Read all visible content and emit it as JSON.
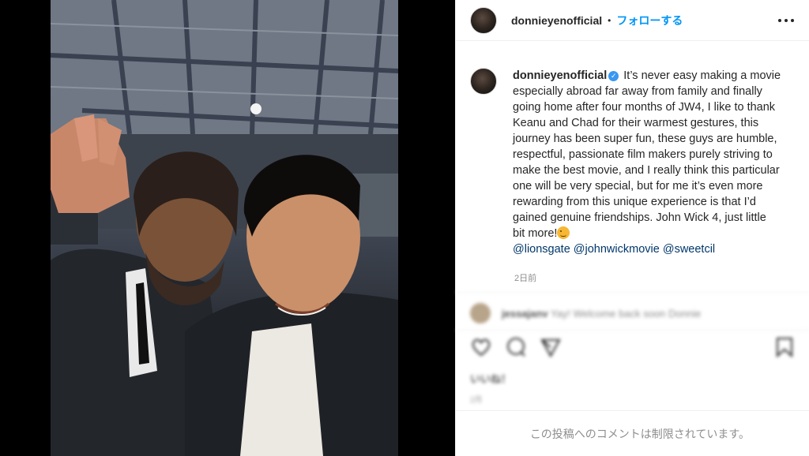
{
  "post": {
    "username": "donnieyenofficial",
    "separator": "•",
    "follow_label": "フォローする",
    "caption": "It’s never easy making a movie especially abroad far away from family and finally going home after four months of JW4, I like to thank Keanu and Chad for their warmest gestures, this journey has been super fun, these guys are humble, respectful, passionate film makers purely striving to make the best movie, and I really think this particular one will be very special, but for me it’s even more rewarding from this unique experience is that I’d gained genuine friendships. John Wick 4, just little bit more!",
    "mentions": [
      "@lionsgate",
      "@johnwickmovie",
      "@sweetcil"
    ],
    "time_ago": "2日前",
    "comments_restricted": "この投稿へのコメントは制限されています。"
  },
  "blurred": {
    "comment_user": "jessajanv",
    "comment_text": "Yay! Welcome back soon Donnie",
    "likes": "いいね！",
    "date": "2月"
  },
  "icons": {
    "more": "more-options-icon",
    "verified": "verified-badge-icon",
    "like": "heart-icon",
    "comment": "comment-icon",
    "share": "share-icon",
    "save": "bookmark-icon",
    "emoji": "wink-emoji-icon"
  },
  "colors": {
    "link": "#00376b",
    "follow": "#0095f6",
    "verified": "#3897f0",
    "muted": "#8e8e8e"
  }
}
